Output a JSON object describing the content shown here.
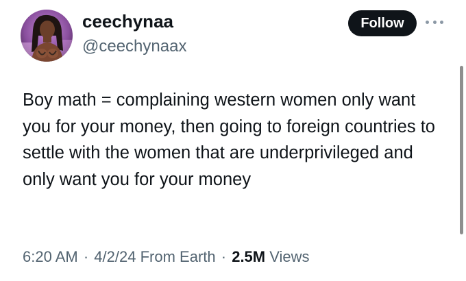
{
  "author": {
    "display_name": "ceechynaa",
    "handle": "@ceechynaax"
  },
  "follow_label": "Follow",
  "more_icon": "more-horizontal-icon",
  "tweet": {
    "text": "Boy math = complaining western women only want you for your money, then going to foreign countries to settle with the women that are underprivileged and only want you for your money"
  },
  "meta": {
    "time": "6:20 AM",
    "date": "4/2/24",
    "location": "From Earth",
    "separator": "·",
    "views_count": "2.5M",
    "views_label": "Views"
  },
  "colors": {
    "text_primary": "#0f1419",
    "text_secondary": "#536471",
    "follow_bg": "#0f1419",
    "background": "#ffffff"
  }
}
